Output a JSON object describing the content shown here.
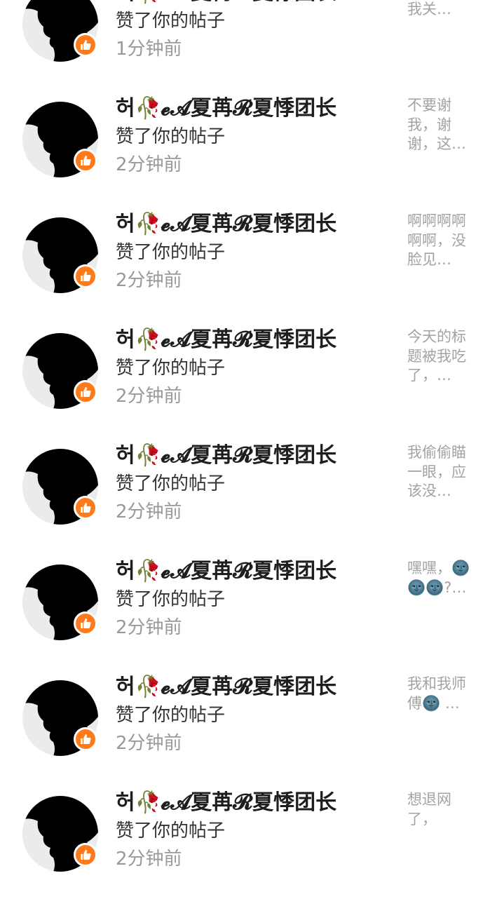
{
  "colors": {
    "badge_bg": "#ff7a1a",
    "avatar_bg": "#ebebeb",
    "name_text": "#1e1e1e",
    "time_text": "#999999",
    "snippet_text": "#a3a3a3"
  },
  "icons": {
    "badge": "thumbs-up-icon",
    "avatar": "silhouette-avatar"
  },
  "notifications": [
    {
      "name": "허🥀𝓮𝓐夏苒𝓡夏悸团长",
      "action": "赞了你的帖子",
      "time": "1分钟前",
      "snippet": "这个，等我关…"
    },
    {
      "name": "허🥀𝓮𝓐夏苒𝓡夏悸团长",
      "action": "赞了你的帖子",
      "time": "2分钟前",
      "snippet": "不要谢我，谢谢，这…"
    },
    {
      "name": "허🥀𝓮𝓐夏苒𝓡夏悸团长",
      "action": "赞了你的帖子",
      "time": "2分钟前",
      "snippet": "啊啊啊啊啊啊，没脸见…"
    },
    {
      "name": "허🥀𝓮𝓐夏苒𝓡夏悸团长",
      "action": "赞了你的帖子",
      "time": "2分钟前",
      "snippet": "今天的标题被我吃了，…"
    },
    {
      "name": "허🥀𝓮𝓐夏苒𝓡夏悸团长",
      "action": "赞了你的帖子",
      "time": "2分钟前",
      "snippet": "我偷偷瞄一眼，应该没…"
    },
    {
      "name": "허🥀𝓮𝓐夏苒𝓡夏悸团长",
      "action": "赞了你的帖子",
      "time": "2分钟前",
      "snippet": "嘿嘿，🌚🌚🌚?…"
    },
    {
      "name": "허🥀𝓮𝓐夏苒𝓡夏悸团长",
      "action": "赞了你的帖子",
      "time": "2分钟前",
      "snippet": "我和我师傅🌚 …"
    },
    {
      "name": "허🥀𝓮𝓐夏苒𝓡夏悸团长",
      "action": "赞了你的帖子",
      "time": "2分钟前",
      "snippet": "想退网了，"
    }
  ]
}
